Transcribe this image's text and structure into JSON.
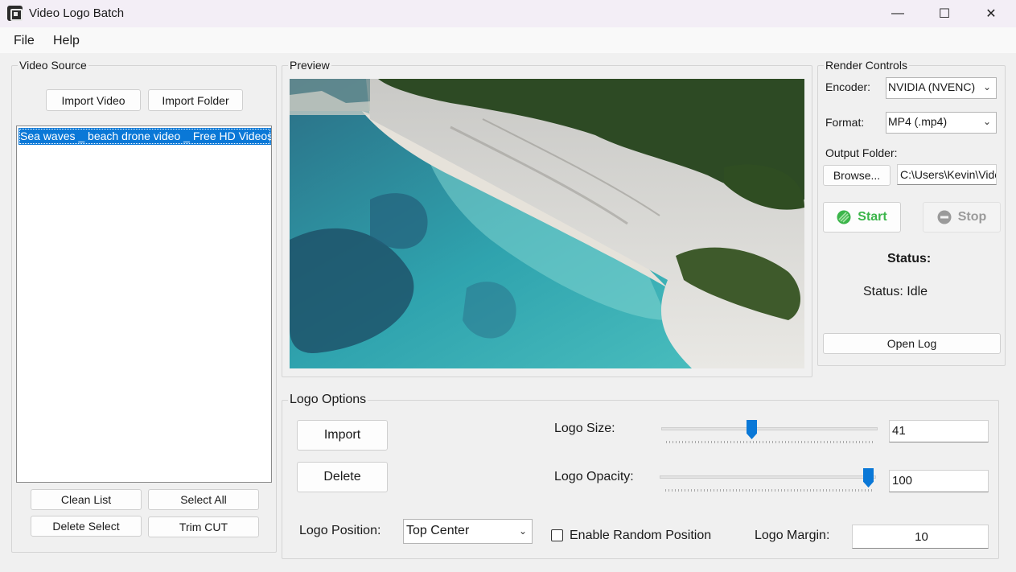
{
  "window": {
    "title": "Video Logo Batch",
    "minimize": "—",
    "maximize": "☐",
    "close": "✕"
  },
  "menu": {
    "file": "File",
    "help": "Help"
  },
  "video_source": {
    "label": "Video Source",
    "import_video": "Import Video",
    "import_folder": "Import Folder",
    "items": [
      "Sea waves _ beach drone video _ Free HD Videos - no copyright"
    ],
    "clean_list": "Clean List",
    "select_all": "Select All",
    "delete_select": "Delete Select",
    "trim_cut": "Trim CUT"
  },
  "preview": {
    "label": "Preview"
  },
  "render_controls": {
    "label": "Render Controls",
    "encoder_label": "Encoder:",
    "encoder_value": "NVIDIA (NVENC)",
    "format_label": "Format:",
    "format_value": "MP4 (.mp4)",
    "output_folder_label": "Output Folder:",
    "browse": "Browse...",
    "output_path": "C:\\Users\\Kevin\\Videos",
    "start": "Start",
    "stop": "Stop",
    "status_heading": "Status:",
    "status_text": "Status: Idle",
    "open_log": "Open Log"
  },
  "logo_options": {
    "label": "Logo Options",
    "import": "Import",
    "delete": "Delete",
    "size_label": "Logo Size:",
    "size_value": "41",
    "size_fraction": 0.41,
    "opacity_label": "Logo Opacity:",
    "opacity_value": "100",
    "opacity_fraction": 1.0,
    "position_label": "Logo Position:",
    "position_value": "Top Center",
    "random_label": "Enable Random Position",
    "random_checked": false,
    "margin_label": "Logo Margin:",
    "margin_value": "10"
  },
  "colors": {
    "accent": "#0a78d7",
    "start_icon": "#3bb54a",
    "stop_icon": "#9a9a9a"
  }
}
